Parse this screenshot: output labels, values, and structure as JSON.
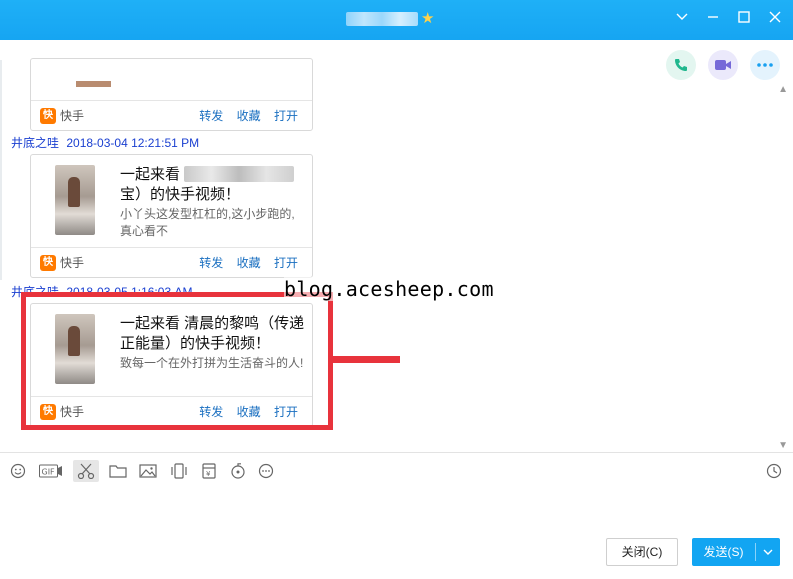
{
  "window": {
    "title_star_icon": "star-icon",
    "controls": [
      "minimize-dropdown",
      "minimize",
      "maximize",
      "close"
    ]
  },
  "header_actions": [
    {
      "name": "voice-call",
      "icon": "phone-icon",
      "color": "#21b78e",
      "bg": "#e3f6f0"
    },
    {
      "name": "video-call",
      "icon": "video-icon",
      "color": "#7669d8",
      "bg": "#ebe9fb"
    },
    {
      "name": "more",
      "icon": "more-icon",
      "color": "#1aa0f0",
      "bg": "#e4f3fd"
    }
  ],
  "messages": [
    {
      "card": {
        "app": "快手",
        "actions": [
          "转发",
          "收藏",
          "打开"
        ]
      }
    },
    {
      "sender": "井底之哇",
      "time": "2018-03-04 12:21:51 PM",
      "card": {
        "title_prefix": "一起来看",
        "title_suffix": "宝）的快手视频！",
        "desc": "小丫头这发型杠杠的,这小步跑的,真心看不",
        "app": "快手",
        "actions": [
          "转发",
          "收藏",
          "打开"
        ]
      }
    },
    {
      "sender": "井底之哇",
      "time": "2018-03-05 1:16:03 AM",
      "card": {
        "title": "一起来看 清晨的黎鸣（传递正能量）的快手视频！",
        "desc": "致每一个在外打拼为生活奋斗的人!",
        "app": "快手",
        "actions": [
          "转发",
          "收藏",
          "打开"
        ]
      }
    }
  ],
  "watermark": "blog.acesheep.com",
  "toolbar": [
    "emoji-icon",
    "gif-icon",
    "scissors-icon",
    "folder-icon",
    "image-icon",
    "shake-icon",
    "red-packet-icon",
    "music-icon",
    "more-circle-icon",
    "history-clock-icon"
  ],
  "buttons": {
    "close_label": "关闭(C)",
    "send_label": "发送(S)"
  },
  "colors": {
    "titlebar": "#16a5f2",
    "highlight": "#e8333c",
    "link": "#1a6fc0",
    "sender": "#1a3fd0",
    "kuaishou": "#ff7a00"
  }
}
